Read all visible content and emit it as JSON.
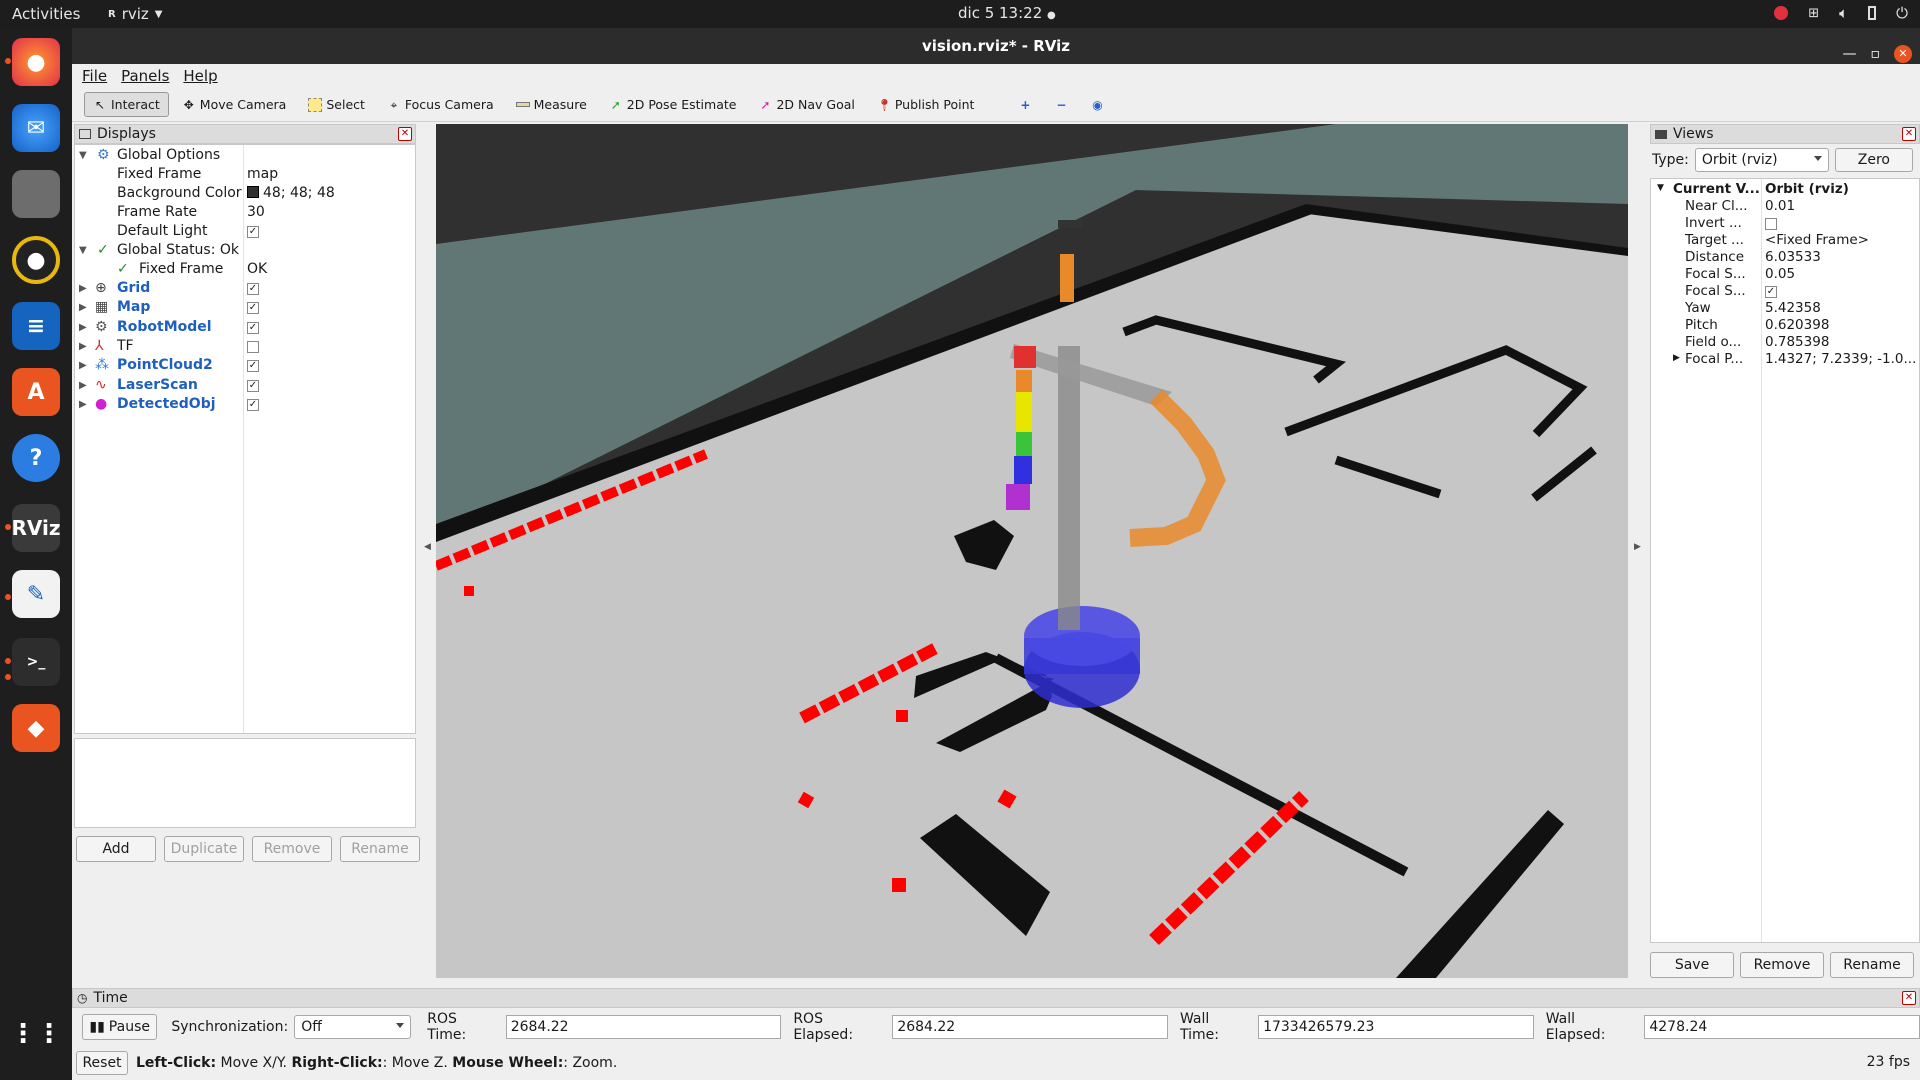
{
  "topbar": {
    "activities": "Activities",
    "app_name": "rviz",
    "app_icon": "rviz-icon",
    "clock": "dic 5  13:22"
  },
  "dock": {
    "items": [
      "firefox-icon",
      "thunderbird-icon",
      "files-icon",
      "rhythmbox-icon",
      "writer-icon",
      "software-icon",
      "help-icon",
      "rviz-icon",
      "text-editor-icon",
      "terminal-icon",
      "layers-icon",
      "app-grid-icon"
    ]
  },
  "window": {
    "title": "vision.rviz* - RViz"
  },
  "menu": {
    "file": "File",
    "panels": "Panels",
    "help": "Help"
  },
  "toolbar": {
    "interact": "Interact",
    "move_camera": "Move Camera",
    "select": "Select",
    "focus_camera": "Focus Camera",
    "measure": "Measure",
    "pose_estimate": "2D Pose Estimate",
    "nav_goal": "2D Nav Goal",
    "publish_point": "Publish Point"
  },
  "displays": {
    "title": "Displays",
    "global_options": "Global Options",
    "fixed_frame_label": "Fixed Frame",
    "fixed_frame_value": "map",
    "bg_color_label": "Background Color",
    "bg_color_value": "48; 48; 48",
    "frame_rate_label": "Frame Rate",
    "frame_rate_value": "30",
    "default_light_label": "Default Light",
    "global_status": "Global Status: Ok",
    "status_fixed_frame": "Fixed Frame",
    "status_fixed_frame_value": "OK",
    "items": [
      {
        "label": "Grid",
        "checked": true
      },
      {
        "label": "Map",
        "checked": true
      },
      {
        "label": "RobotModel",
        "checked": true
      },
      {
        "label": "TF",
        "checked": false
      },
      {
        "label": "PointCloud2",
        "checked": true
      },
      {
        "label": "LaserScan",
        "checked": true
      },
      {
        "label": "DetectedObj",
        "checked": true
      }
    ],
    "buttons": {
      "add": "Add",
      "duplicate": "Duplicate",
      "remove": "Remove",
      "rename": "Rename"
    }
  },
  "views": {
    "title": "Views",
    "type_label": "Type:",
    "type_value": "Orbit (rviz)",
    "zero": "Zero",
    "current_label": "Current V...",
    "current_value": "Orbit (rviz)",
    "props": [
      {
        "k": "Near Cl...",
        "v": "0.01"
      },
      {
        "k": "Invert ...",
        "v": ""
      },
      {
        "k": "Target ...",
        "v": "<Fixed Frame>"
      },
      {
        "k": "Distance",
        "v": "6.03533"
      },
      {
        "k": "Focal S...",
        "v": "0.05"
      },
      {
        "k": "Focal S...",
        "v": ""
      },
      {
        "k": "Yaw",
        "v": "5.42358"
      },
      {
        "k": "Pitch",
        "v": "0.620398"
      },
      {
        "k": "Field o...",
        "v": "0.785398"
      },
      {
        "k": "Focal P...",
        "v": "1.4327; 7.2339; -1.0..."
      }
    ],
    "buttons": {
      "save": "Save",
      "remove": "Remove",
      "rename": "Rename"
    }
  },
  "time": {
    "title": "Time",
    "pause": "Pause",
    "sync_label": "Synchronization:",
    "sync_value": "Off",
    "ros_time_label": "ROS Time:",
    "ros_time": "2684.22",
    "ros_elapsed_label": "ROS Elapsed:",
    "ros_elapsed": "2684.22",
    "wall_time_label": "Wall Time:",
    "wall_time": "1733426579.23",
    "wall_elapsed_label": "Wall Elapsed:",
    "wall_elapsed": "4278.24"
  },
  "status": {
    "reset": "Reset",
    "lc": "Left-Click:",
    "lc_t": " Move X/Y. ",
    "rc": "Right-Click:",
    "rc_t": ": Move Z. ",
    "mw": "Mouse Wheel:",
    "mw_t": ": Zoom.",
    "fps": "23 fps"
  },
  "colors": {
    "laser": "#ff0000",
    "robot_base": "#3030cc",
    "arm": "#e8892a",
    "floor": "#c8c8c8"
  }
}
